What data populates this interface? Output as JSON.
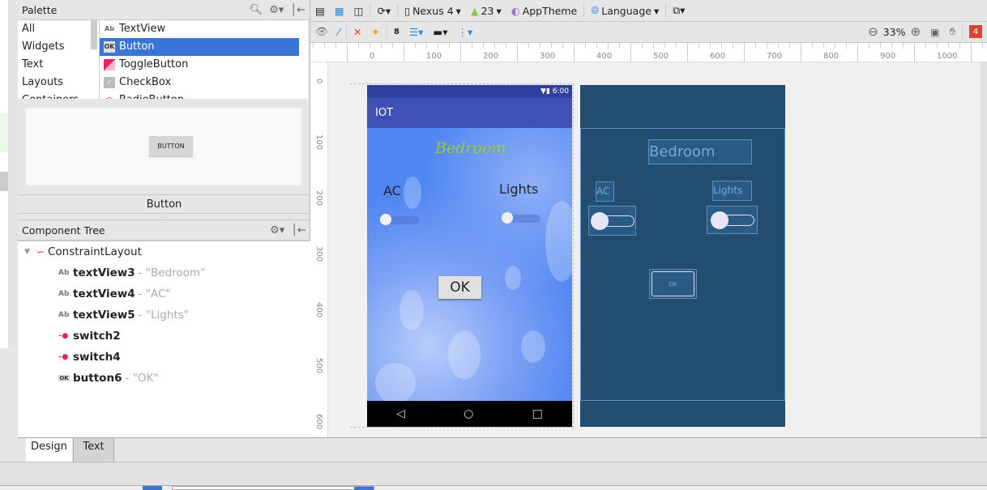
{
  "palette": {
    "title": "Palette",
    "categories": [
      "All",
      "Widgets",
      "Text",
      "Layouts",
      "Containers"
    ],
    "items": [
      {
        "icon": "Ab",
        "label": "TextView"
      },
      {
        "icon": "OK",
        "label": "Button"
      },
      {
        "icon": "toggle",
        "label": "ToggleButton"
      },
      {
        "icon": "check",
        "label": "CheckBox"
      },
      {
        "icon": "radio",
        "label": "RadioButton"
      }
    ],
    "selected": "Button",
    "preview_button": "BUTTON",
    "preview_label": "Button"
  },
  "component_tree": {
    "title": "Component Tree",
    "root": "ConstraintLayout",
    "nodes": [
      {
        "icon": "Ab",
        "id": "textView3",
        "text": "- \"Bedroom\""
      },
      {
        "icon": "Ab",
        "id": "textView4",
        "text": "- \"AC\""
      },
      {
        "icon": "Ab",
        "id": "textView5",
        "text": "- \"Lights\""
      },
      {
        "icon": "switch",
        "id": "switch2",
        "text": ""
      },
      {
        "icon": "switch",
        "id": "switch4",
        "text": ""
      },
      {
        "icon": "OK",
        "id": "button6",
        "text": "- \"OK\""
      }
    ]
  },
  "tabs": [
    "Design",
    "Text"
  ],
  "active_tab": "Design",
  "toolbar": {
    "device": "Nexus 4",
    "api": "23",
    "theme": "AppTheme",
    "language": "Language",
    "zoom": "33%",
    "warnings": "4"
  },
  "ruler": {
    "x": [
      "0",
      "100",
      "200",
      "300",
      "400",
      "500",
      "600",
      "700",
      "800",
      "900",
      "1000"
    ],
    "y": [
      "0",
      "100",
      "200",
      "300",
      "400",
      "500",
      "600"
    ]
  },
  "phone": {
    "time": "6:00",
    "app_title": "IOT",
    "heading": "Bedroom",
    "ac": "AC",
    "lights": "Lights",
    "ok": "OK",
    "ac_on": false,
    "lights_on": false
  },
  "blueprint": {
    "heading": "Bedroom",
    "ac": "AC",
    "lights": "Lights",
    "ok": "OK"
  },
  "colors": {
    "accent": "#3875d7",
    "appbar": "#3f51b5",
    "blueprint": "#224d6f",
    "heading": "#9acd32"
  }
}
